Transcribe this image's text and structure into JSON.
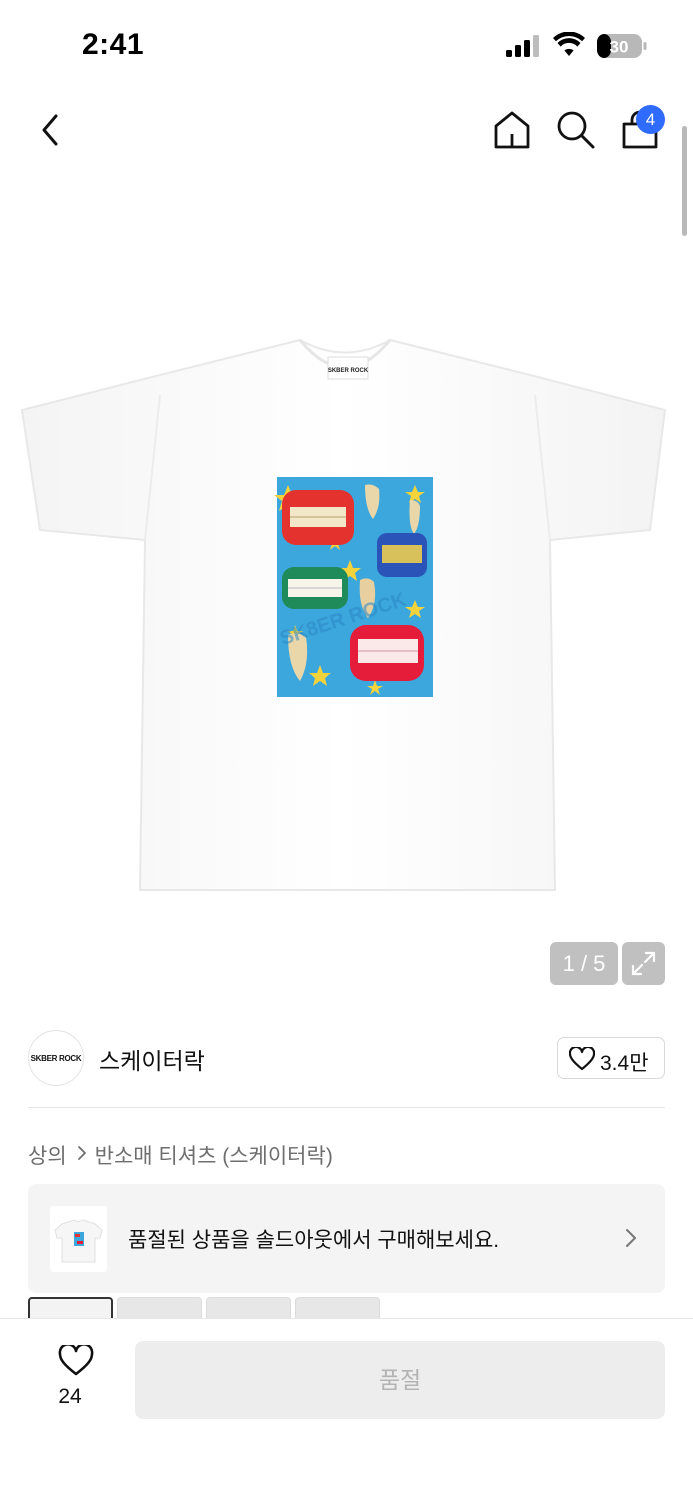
{
  "status_bar": {
    "time": "2:41",
    "battery": "30"
  },
  "nav": {
    "back_icon": "chevron-left-icon",
    "home_icon": "home-icon",
    "search_icon": "search-icon",
    "cart_icon": "shopping-bag-icon",
    "cart_count": "4"
  },
  "gallery": {
    "page_counter": "1 / 5",
    "expand_icon": "expand-icon",
    "collar_label": "SKBER ROCK",
    "print_watermark": "SK8ER ROCK"
  },
  "brand": {
    "logo_text": "SKBER ROCK",
    "name": "스케이터락",
    "likes": "3.4만"
  },
  "breadcrumb": {
    "category": "상의",
    "subcategory": "반소매 티셔츠 (스케이터락)"
  },
  "soldout_banner": {
    "text": "품절된 상품을 솔드아웃에서 구매해보세요."
  },
  "bottom_bar": {
    "like_count": "24",
    "buy_label": "품절"
  },
  "colors": {
    "accent_badge": "#2f6bff",
    "button_disabled": "#ededed",
    "button_disabled_text": "#b3b3b3"
  }
}
